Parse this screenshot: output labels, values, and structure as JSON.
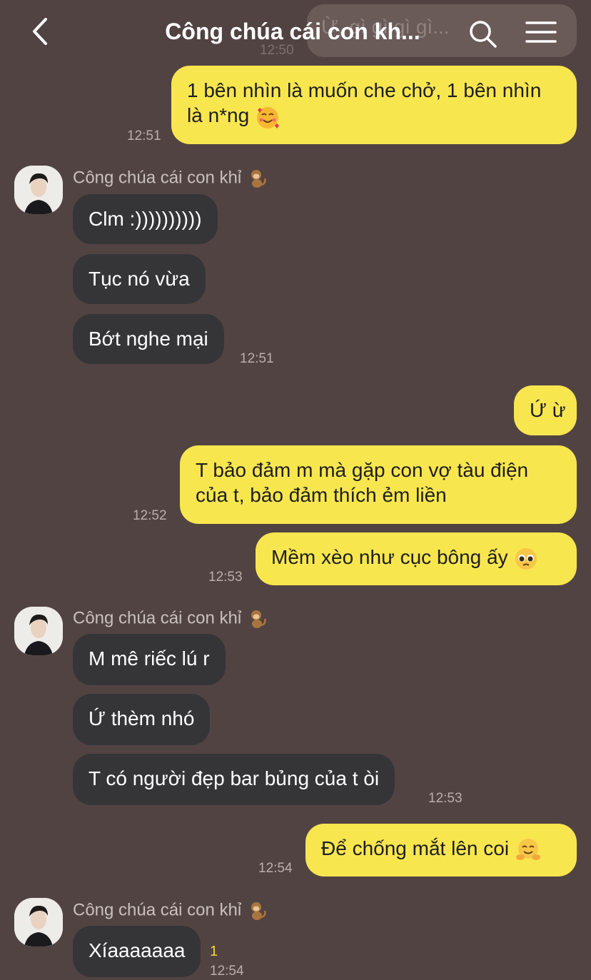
{
  "header": {
    "title": "Công chúa cái con kh...",
    "back_icon": "chevron-left-icon",
    "search_icon": "search-icon",
    "menu_icon": "hamburger-menu-icon"
  },
  "contact": {
    "name": "Công chúa cái con khỉ",
    "name_emoji": "monkey-emoji"
  },
  "messages": [
    {
      "from": "me",
      "text": "Ừ, gì gì gì gì...",
      "time": "12:50",
      "faded": true
    },
    {
      "from": "me",
      "line1": "1 bên nhìn là muốn che chở, 1 bên nhìn",
      "line2": "là n*ng",
      "emoji": "smiling-hearts-emoji",
      "time": "12:51"
    },
    {
      "from": "them",
      "text": "Clm :))))))))))"
    },
    {
      "from": "them",
      "text": "Tục nó vừa"
    },
    {
      "from": "them",
      "text": "Bớt nghe mại",
      "time": "12:51"
    },
    {
      "from": "me",
      "text": "Ứ ừ"
    },
    {
      "from": "me",
      "line1": "T bảo đảm m mà gặp con vợ tàu điện",
      "line2": "của t, bảo đảm thích ẻm liền",
      "time": "12:52"
    },
    {
      "from": "me",
      "text": "Mềm xèo như cục bông ấy",
      "emoji": "pleading-emoji",
      "time": "12:53"
    },
    {
      "from": "them",
      "text": "M mê riếc lú r"
    },
    {
      "from": "them",
      "text": "Ứ thèm nhó"
    },
    {
      "from": "them",
      "text": "T có người đẹp bar bủng của t òi",
      "time": "12:53"
    },
    {
      "from": "me",
      "text": "Để chống mắt lên coi",
      "emoji": "hugging-emoji",
      "time": "12:54"
    },
    {
      "from": "them",
      "text": "Xíaaaaaaa",
      "time": "12:54",
      "unread": "1"
    }
  ],
  "colors": {
    "background": "#524343",
    "my_bubble": "#f8e64f",
    "their_bubble": "#353538",
    "unread_count": "#f4d83a"
  }
}
